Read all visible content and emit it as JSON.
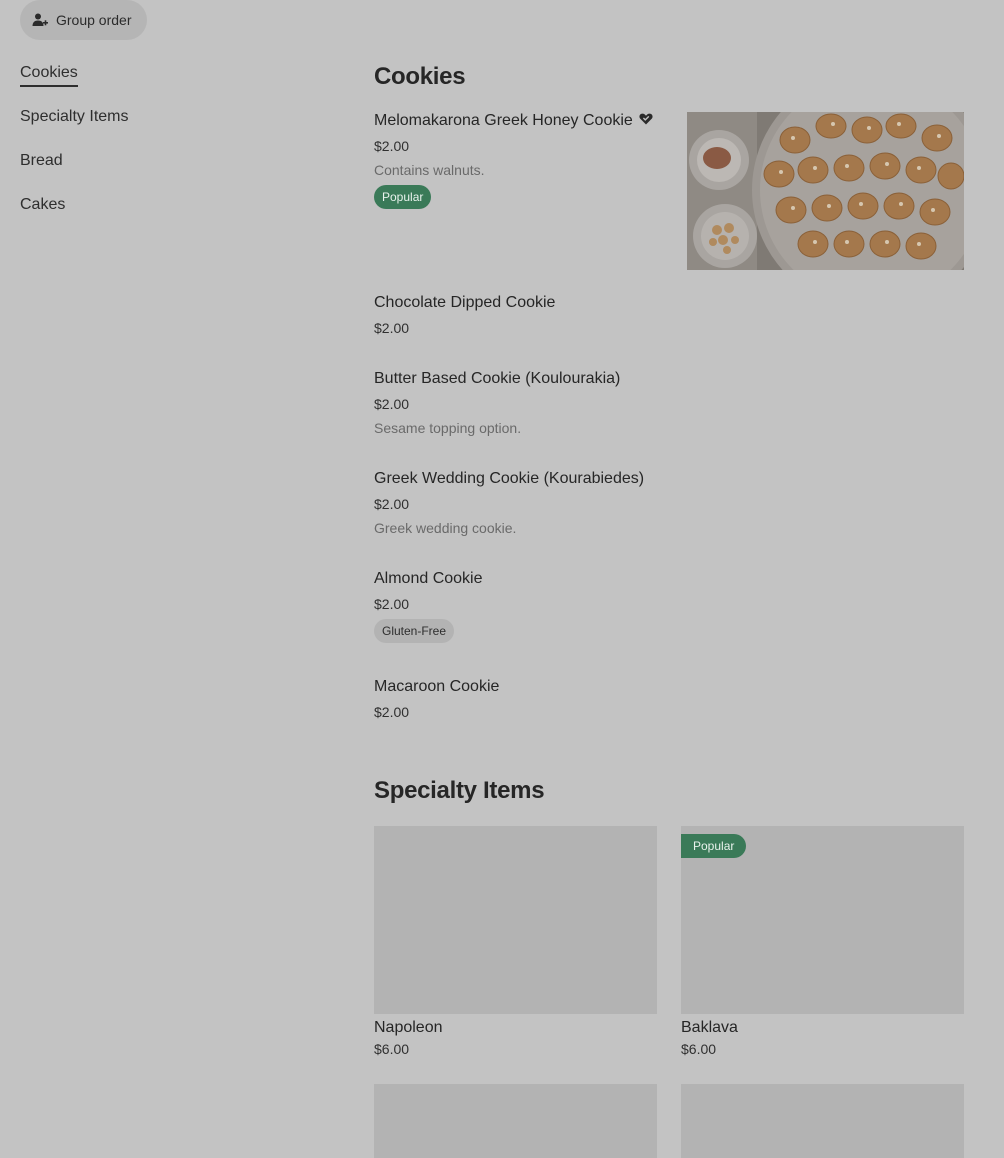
{
  "header": {
    "group_order_label": "Group order",
    "group_order_icon": "add-person-icon"
  },
  "sidebar": {
    "items": [
      {
        "label": "Cookies",
        "active": true
      },
      {
        "label": "Specialty Items",
        "active": false
      },
      {
        "label": "Bread",
        "active": false
      },
      {
        "label": "Cakes",
        "active": false
      }
    ]
  },
  "sections": {
    "cookies": {
      "title": "Cookies",
      "items": [
        {
          "name": "Melomakarona Greek Honey Cookie",
          "price": "$2.00",
          "description": "Contains walnuts.",
          "badge": "Popular",
          "icon": "heart-icon"
        },
        {
          "name": "Chocolate Dipped Cookie",
          "price": "$2.00"
        },
        {
          "name": "Butter Based Cookie (Koulourakia)",
          "price": "$2.00",
          "description": "Sesame topping option."
        },
        {
          "name": "Greek Wedding Cookie (Kourabiedes)",
          "price": "$2.00",
          "description": "Greek wedding cookie."
        },
        {
          "name": "Almond Cookie",
          "price": "$2.00",
          "badge": "Gluten-Free"
        },
        {
          "name": "Macaroon Cookie",
          "price": "$2.00"
        }
      ]
    },
    "specialty": {
      "title": "Specialty Items",
      "items": [
        {
          "name": "Napoleon",
          "price": "$6.00"
        },
        {
          "name": "Baklava",
          "price": "$6.00",
          "badge": "Popular"
        }
      ]
    }
  },
  "colors": {
    "background": "#c3c3c3",
    "popular_badge": "#3a7a58",
    "placeholder": "#b3b3b3"
  }
}
